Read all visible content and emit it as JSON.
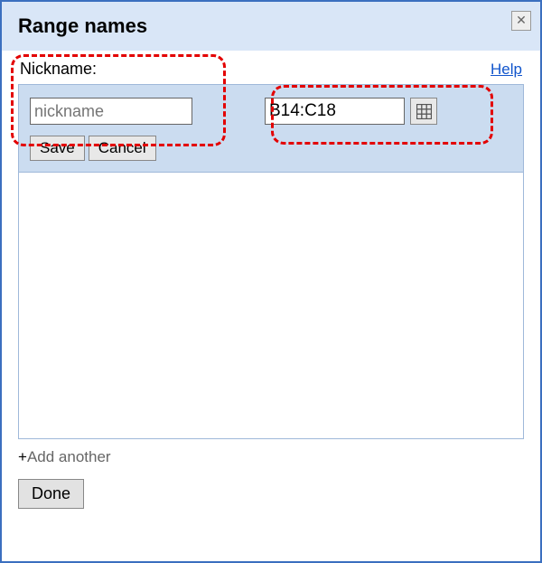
{
  "dialog": {
    "title": "Range names",
    "nickname_label": "Nickname:",
    "help_link": "Help",
    "nickname_placeholder": "nickname",
    "nickname_value": "",
    "range_value": "B14:C18",
    "save_label": "Save",
    "cancel_label": "Cancel",
    "add_another_plus": "+",
    "add_another_label": "Add another",
    "done_label": "Done"
  }
}
